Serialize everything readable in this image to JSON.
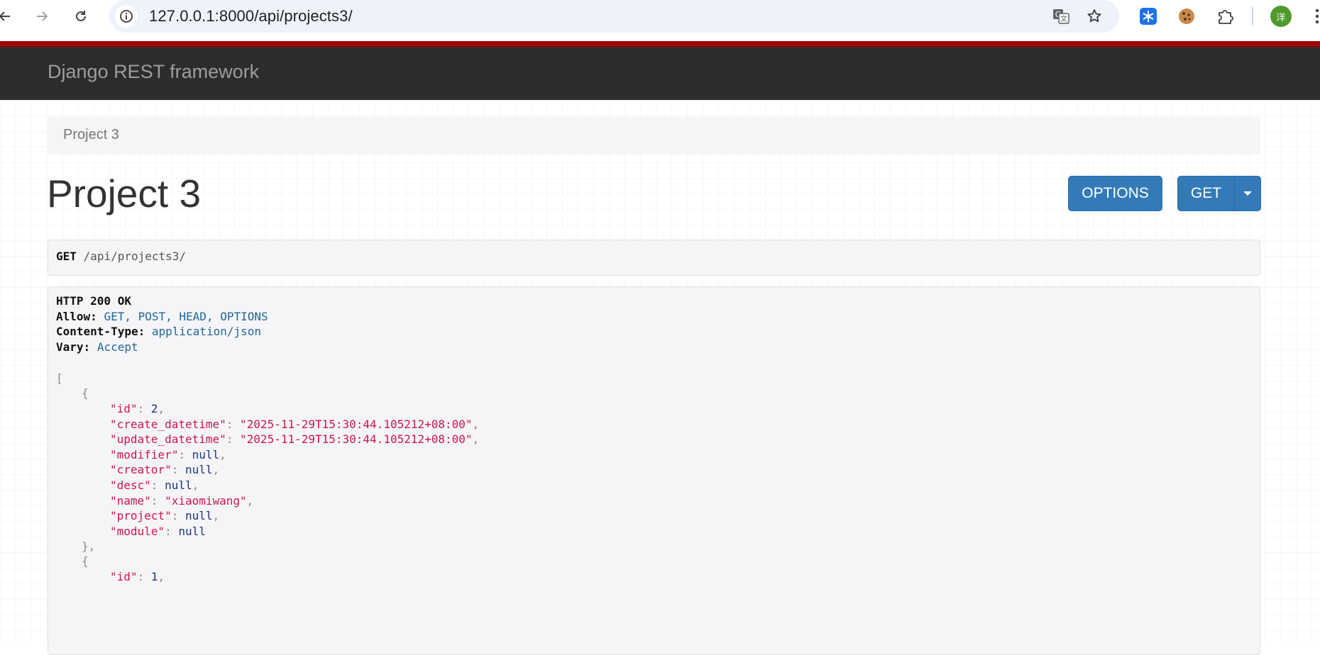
{
  "browser": {
    "url": "127.0.0.1:8000/api/projects3/",
    "profile_initial": "洋",
    "icons": [
      "back-arrow-icon",
      "forward-arrow-icon",
      "reload-icon",
      "site-info-icon",
      "translate-icon",
      "bookmark-star-icon",
      "snowflake-extension-icon",
      "cookie-extension-icon",
      "extensions-puzzle-icon",
      "menu-dots-icon"
    ]
  },
  "navbar": {
    "brand": "Django REST framework",
    "accent_color": "#a30000",
    "bg_color": "#2c2c2c"
  },
  "breadcrumb": {
    "items": [
      "Project 3"
    ]
  },
  "page": {
    "title": "Project 3"
  },
  "buttons": {
    "options": "OPTIONS",
    "get": "GET",
    "color": "#337ab7"
  },
  "request": {
    "method": "GET",
    "path": "/api/projects3/"
  },
  "response": {
    "status": "HTTP 200 OK",
    "headers": [
      {
        "name": "Allow:",
        "value": "GET, POST, HEAD, OPTIONS"
      },
      {
        "name": "Content-Type:",
        "value": "application/json"
      },
      {
        "name": "Vary:",
        "value": "Accept"
      }
    ],
    "open_bracket": "[",
    "open_brace": "{",
    "close_brace": "},",
    "item1": [
      {
        "key": "\"id\"",
        "value": "2",
        "type": "num",
        "comma": ","
      },
      {
        "key": "\"create_datetime\"",
        "value": "\"2025-11-29T15:30:44.105212+08:00\"",
        "type": "str",
        "comma": ","
      },
      {
        "key": "\"update_datetime\"",
        "value": "\"2025-11-29T15:30:44.105212+08:00\"",
        "type": "str",
        "comma": ","
      },
      {
        "key": "\"modifier\"",
        "value": "null",
        "type": "nul",
        "comma": ","
      },
      {
        "key": "\"creator\"",
        "value": "null",
        "type": "nul",
        "comma": ","
      },
      {
        "key": "\"desc\"",
        "value": "null",
        "type": "nul",
        "comma": ","
      },
      {
        "key": "\"name\"",
        "value": "\"xiaomiwang\"",
        "type": "str",
        "comma": ","
      },
      {
        "key": "\"project\"",
        "value": "null",
        "type": "nul",
        "comma": ","
      },
      {
        "key": "\"module\"",
        "value": "null",
        "type": "nul",
        "comma": ""
      }
    ],
    "item2_first": {
      "key": "\"id\"",
      "value": "1",
      "type": "num",
      "comma": ","
    }
  }
}
